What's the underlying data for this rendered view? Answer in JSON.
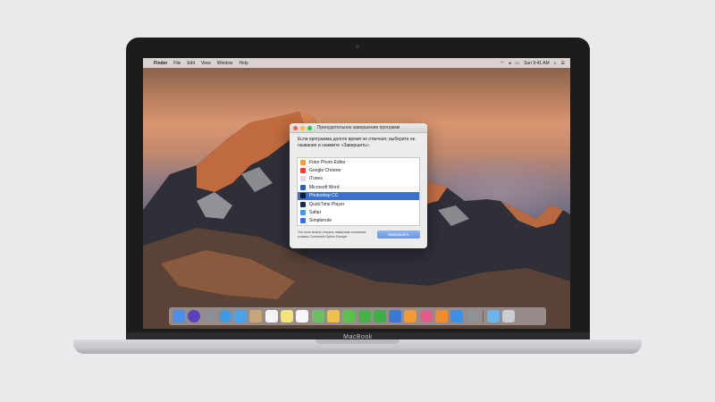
{
  "menubar": {
    "app_name": "Finder",
    "items": [
      "File",
      "Edit",
      "View",
      "Window",
      "Help"
    ],
    "clock": "Sun 9:41 AM"
  },
  "dialog": {
    "title": "Принудительное завершение программ",
    "instruction": "Если программа долгое время не отвечает, выберите ее название и нажмите «Завершить».",
    "apps": [
      {
        "name": "Fotor Photo Editor",
        "icon": "fotor-icon",
        "color": "#e8a23a"
      },
      {
        "name": "Google Chrome",
        "icon": "chrome-icon",
        "color": "#e34133"
      },
      {
        "name": "iTunes",
        "icon": "itunes-icon",
        "color": "#d9d9e8"
      },
      {
        "name": "Microsoft Word",
        "icon": "word-icon",
        "color": "#2b5fb8"
      },
      {
        "name": "Photoshop CC",
        "icon": "photoshop-icon",
        "color": "#0d1d3a"
      },
      {
        "name": "QuickTime Player",
        "icon": "quicktime-icon",
        "color": "#1d2b46"
      },
      {
        "name": "Safari",
        "icon": "safari-icon",
        "color": "#3d9ae8"
      },
      {
        "name": "Simplenote",
        "icon": "simplenote-icon",
        "color": "#3c6fd1"
      }
    ],
    "selected_index": 4,
    "hint": "Это окно можно открыть нажатием сочетания клавиш Command-Option-Escape.",
    "force_quit_label": "Завершить"
  },
  "laptop": {
    "brand": "MacBook"
  },
  "dock": {
    "apps": [
      {
        "icon": "finder-icon",
        "color": "#4d8fe3"
      },
      {
        "icon": "siri-icon",
        "color": "#5a3fc0"
      },
      {
        "icon": "launchpad-icon",
        "color": "#8a8f99"
      },
      {
        "icon": "safari-icon",
        "color": "#3d9ae8"
      },
      {
        "icon": "mail-icon",
        "color": "#4aa3e8"
      },
      {
        "icon": "contacts-icon",
        "color": "#c7a77a"
      },
      {
        "icon": "calendar-icon",
        "color": "#f4f4f4"
      },
      {
        "icon": "notes-icon",
        "color": "#f2e37a"
      },
      {
        "icon": "reminders-icon",
        "color": "#f6f6f6"
      },
      {
        "icon": "maps-icon",
        "color": "#6cbf64"
      },
      {
        "icon": "photos-icon",
        "color": "#f0c14a"
      },
      {
        "icon": "messages-icon",
        "color": "#5ec04f"
      },
      {
        "icon": "facetime-icon",
        "color": "#47b04a"
      },
      {
        "icon": "numbers-icon",
        "color": "#3fae49"
      },
      {
        "icon": "keynote-icon",
        "color": "#3c78d8"
      },
      {
        "icon": "pages-icon",
        "color": "#f29a37"
      },
      {
        "icon": "itunes-icon",
        "color": "#e65a8c"
      },
      {
        "icon": "ibooks-icon",
        "color": "#f28b2b"
      },
      {
        "icon": "app-store-icon",
        "color": "#3e8fe6"
      },
      {
        "icon": "system-preferences-icon",
        "color": "#8e9299"
      },
      {
        "icon": "downloads-folder-icon",
        "color": "#6bb3e8"
      },
      {
        "icon": "trash-icon",
        "color": "#c9ccd1"
      }
    ]
  }
}
